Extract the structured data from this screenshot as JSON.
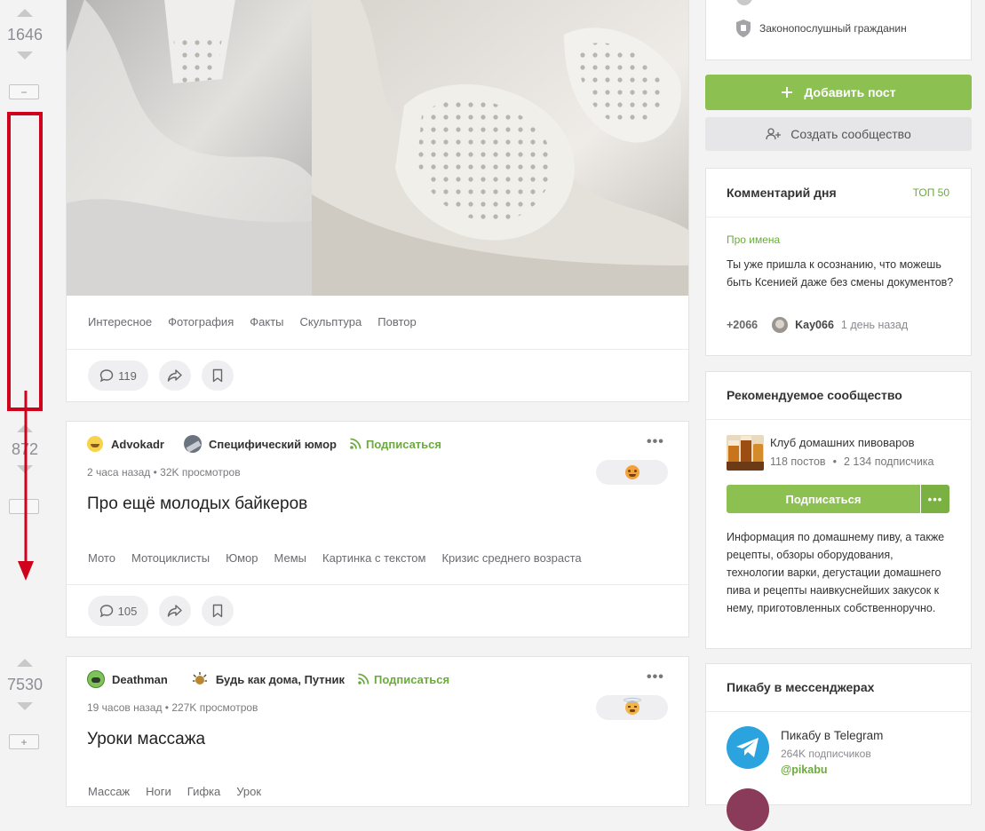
{
  "votes": [
    {
      "score": "1646",
      "action": "−"
    },
    {
      "score": "872",
      "action": ""
    },
    {
      "score": "7530",
      "action": "+"
    }
  ],
  "post1": {
    "tags": [
      "Интересное",
      "Фотография",
      "Факты",
      "Скульптура",
      "Повтор"
    ],
    "comments": "119"
  },
  "post2": {
    "author": "Advokadr",
    "community": "Специфический юмор",
    "subscribe": "Подписаться",
    "meta": "2 часа назад • 32K просмотров",
    "title": "Про ещё молодых байкеров",
    "tags": [
      "Мото",
      "Мотоциклисты",
      "Юмор",
      "Мемы",
      "Картинка с текстом",
      "Кризис среднего возраста"
    ],
    "comments": "105"
  },
  "post3": {
    "author": "Deathman",
    "community": "Будь как дома, Путник",
    "subscribe": "Подписаться",
    "meta": "19 часов назад • 227K просмотров",
    "title": "Уроки массажа",
    "tags": [
      "Массаж",
      "Ноги",
      "Гифка",
      "Урок"
    ]
  },
  "sidebar": {
    "badge_label": "Законопослушный гражданин",
    "add_post": "Добавить пост",
    "create_community": "Создать сообщество",
    "comment_of_day": {
      "title": "Комментарий дня",
      "top": "ТОП 50",
      "post_link": "Про имена",
      "text": "Ты уже пришла к осознанию, что можешь быть Ксенией даже без смены документов?",
      "score": "+2066",
      "user": "Kay066",
      "time": "1 день назад"
    },
    "recommended": {
      "title": "Рекомендуемое сообщество",
      "name": "Клуб домашних пивоваров",
      "posts": "118 постов",
      "subscribers": "2 134 подписчика",
      "subscribe": "Подписаться",
      "description": "Информация по домашнему пиву, а также рецепты, обзоры оборудования, технологии варки, дегустации домашнего пива и рецепты наивкуснейших закусок к нему, приготовленных собственноручно."
    },
    "messengers": {
      "title": "Пикабу в мессенджерах",
      "name": "Пикабу в Telegram",
      "subs": "264K подписчиков",
      "handle": "@pikabu"
    }
  },
  "colors": {
    "accent_green": "#8cc152",
    "annotation_red": "#d0021b"
  }
}
